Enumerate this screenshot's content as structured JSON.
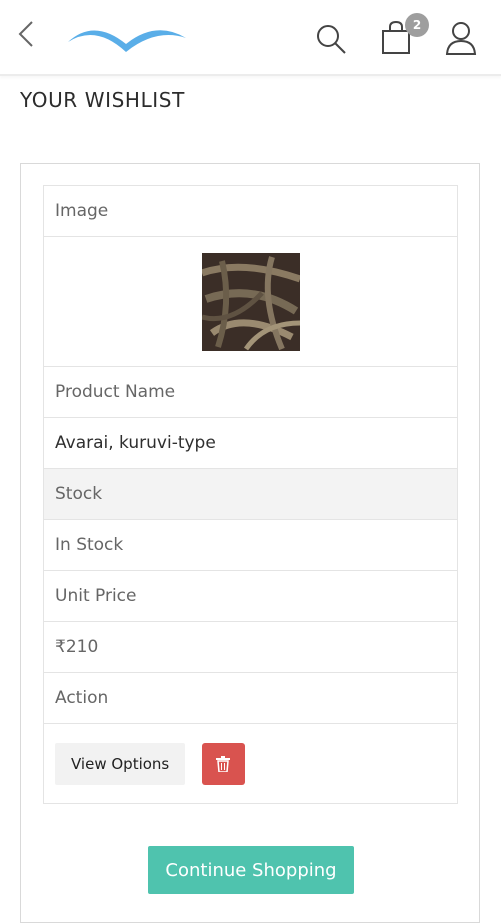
{
  "header": {
    "back_icon": "chevron-left-icon",
    "logo_icon": "bird-wings-logo",
    "search_icon": "search-icon",
    "cart_icon": "shopping-bag-icon",
    "cart_count": "2",
    "account_icon": "user-icon",
    "logo_color": "#5aaee8"
  },
  "page": {
    "title": "YOUR WISHLIST"
  },
  "wishlist": {
    "image_label": "Image",
    "product_name_label": "Product Name",
    "product_name": "Avarai, kuruvi-type",
    "stock_label": "Stock",
    "stock_value": "In Stock",
    "unit_price_label": "Unit Price",
    "unit_price": "₹210",
    "action_label": "Action",
    "view_options_label": "View Options",
    "delete_icon": "trash-icon"
  },
  "footer": {
    "continue_label": "Continue Shopping"
  },
  "colors": {
    "accent": "#4fc3ae",
    "danger": "#d9534f",
    "badge": "#9e9e9e"
  }
}
